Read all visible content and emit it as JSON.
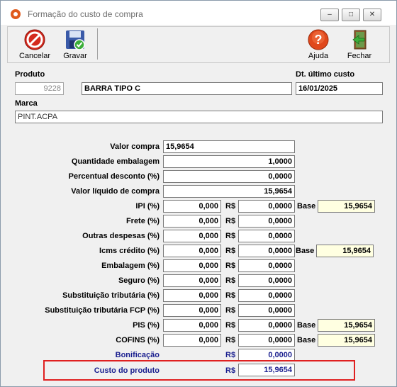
{
  "window": {
    "title": "Formação do custo de compra",
    "controls": {
      "minimize": "–",
      "maximize": "□",
      "close": "✕"
    }
  },
  "toolbar": {
    "cancel_label": "Cancelar",
    "save_label": "Gravar",
    "help_label": "Ajuda",
    "close_label": "Fechar"
  },
  "produto": {
    "label": "Produto",
    "code": "9228",
    "name": "BARRA TIPO C"
  },
  "dt_ultimo_custo": {
    "label": "Dt. último custo",
    "value": "16/01/2025"
  },
  "marca": {
    "label": "Marca",
    "value": "PINT.ACPA"
  },
  "currency": "R$",
  "base_label": "Base",
  "rows": {
    "valor_compra": {
      "label": "Valor compra",
      "value": "15,9654"
    },
    "quantidade": {
      "label": "Quantidade embalagem",
      "value": "1,0000"
    },
    "perc_desconto": {
      "label": "Percentual desconto (%)",
      "value": "0,0000"
    },
    "valor_liquido": {
      "label": "Valor líquido de compra",
      "value": "15,9654"
    },
    "ipi": {
      "label": "IPI (%)",
      "pct": "0,000",
      "value": "0,0000",
      "base": "15,9654"
    },
    "frete": {
      "label": "Frete (%)",
      "pct": "0,000",
      "value": "0,0000"
    },
    "outras": {
      "label": "Outras despesas (%)",
      "pct": "0,000",
      "value": "0,0000"
    },
    "icms": {
      "label": "Icms crédito (%)",
      "pct": "0,000",
      "value": "0,0000",
      "base": "15,9654"
    },
    "embalagem": {
      "label": "Embalagem (%)",
      "pct": "0,000",
      "value": "0,0000"
    },
    "seguro": {
      "label": "Seguro (%)",
      "pct": "0,000",
      "value": "0,0000"
    },
    "st": {
      "label": "Substituição tributária (%)",
      "pct": "0,000",
      "value": "0,0000"
    },
    "st_fcp": {
      "label": "Substituição tributária FCP (%)",
      "pct": "0,000",
      "value": "0,0000"
    },
    "pis": {
      "label": "PIS (%)",
      "pct": "0,000",
      "value": "0,0000",
      "base": "15,9654"
    },
    "cofins": {
      "label": "COFINS (%)",
      "pct": "0,000",
      "value": "0,0000",
      "base": "15,9654"
    },
    "bonificacao": {
      "label": "Bonificação",
      "value": "0,0000"
    },
    "custo": {
      "label": "Custo do produto",
      "value": "15,9654"
    }
  }
}
